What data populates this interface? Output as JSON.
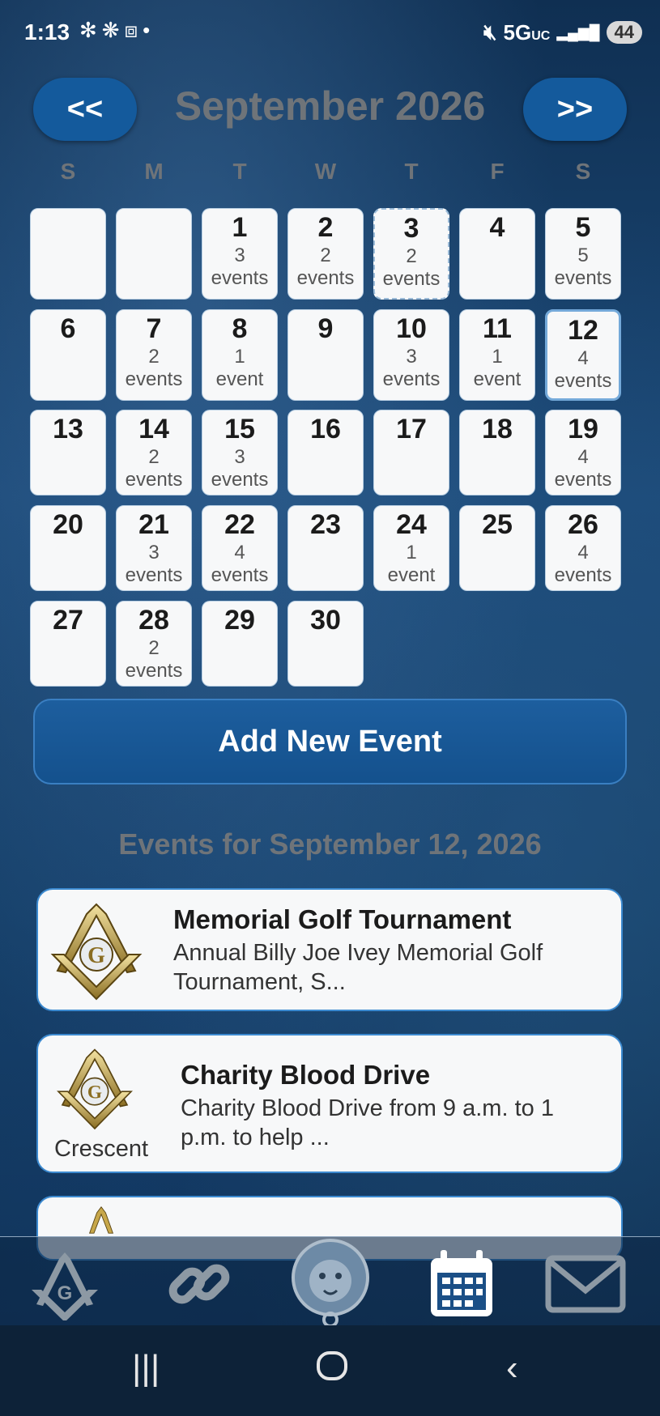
{
  "status_bar": {
    "time": "1:13",
    "network": "5G",
    "network_sub": "UC",
    "battery": "44"
  },
  "header": {
    "prev_label": "<<",
    "next_label": ">>",
    "month_title": "September 2026"
  },
  "weekdays": [
    "S",
    "M",
    "T",
    "W",
    "T",
    "F",
    "S"
  ],
  "calendar_rows": [
    [
      {
        "num": "",
        "count": "",
        "label": ""
      },
      {
        "num": "",
        "count": "",
        "label": ""
      },
      {
        "num": "1",
        "count": "3",
        "label": "events"
      },
      {
        "num": "2",
        "count": "2",
        "label": "events"
      },
      {
        "num": "3",
        "count": "2",
        "label": "events"
      },
      {
        "num": "4",
        "count": "",
        "label": ""
      },
      {
        "num": "5",
        "count": "5",
        "label": "events"
      }
    ],
    [
      {
        "num": "6",
        "count": "",
        "label": ""
      },
      {
        "num": "7",
        "count": "2",
        "label": "events"
      },
      {
        "num": "8",
        "count": "1",
        "label": "event"
      },
      {
        "num": "9",
        "count": "",
        "label": ""
      },
      {
        "num": "10",
        "count": "3",
        "label": "events"
      },
      {
        "num": "11",
        "count": "1",
        "label": "event"
      },
      {
        "num": "12",
        "count": "4",
        "label": "events"
      }
    ],
    [
      {
        "num": "13",
        "count": "",
        "label": ""
      },
      {
        "num": "14",
        "count": "2",
        "label": "events"
      },
      {
        "num": "15",
        "count": "3",
        "label": "events"
      },
      {
        "num": "16",
        "count": "",
        "label": ""
      },
      {
        "num": "17",
        "count": "",
        "label": ""
      },
      {
        "num": "18",
        "count": "",
        "label": ""
      },
      {
        "num": "19",
        "count": "4",
        "label": "events"
      }
    ],
    [
      {
        "num": "20",
        "count": "",
        "label": ""
      },
      {
        "num": "21",
        "count": "3",
        "label": "events"
      },
      {
        "num": "22",
        "count": "4",
        "label": "events"
      },
      {
        "num": "23",
        "count": "",
        "label": ""
      },
      {
        "num": "24",
        "count": "1",
        "label": "event"
      },
      {
        "num": "25",
        "count": "",
        "label": ""
      },
      {
        "num": "26",
        "count": "4",
        "label": "events"
      }
    ],
    [
      {
        "num": "27",
        "count": "",
        "label": ""
      },
      {
        "num": "28",
        "count": "2",
        "label": "events"
      },
      {
        "num": "29",
        "count": "",
        "label": ""
      },
      {
        "num": "30",
        "count": "",
        "label": ""
      }
    ]
  ],
  "today_day": "3",
  "selected_day": "12",
  "add_button_label": "Add New Event",
  "events_title": "Events for September 12, 2026",
  "events": [
    {
      "title": "Memorial Golf Tournament",
      "description": "Annual Billy Joe Ivey Memorial Golf Tournament,  S...",
      "lodge": ""
    },
    {
      "title": "Charity Blood Drive",
      "description": "Charity Blood Drive from 9 a.m. to 1 p.m. to help ...",
      "lodge": "Crescent"
    }
  ],
  "bottom_nav": [
    "masonic-icon",
    "link-icon",
    "lion-icon",
    "calendar-icon",
    "mail-icon"
  ],
  "colors": {
    "accent": "#145a9c",
    "card_border": "#3c8ad0",
    "muted_text": "#6f7479"
  }
}
